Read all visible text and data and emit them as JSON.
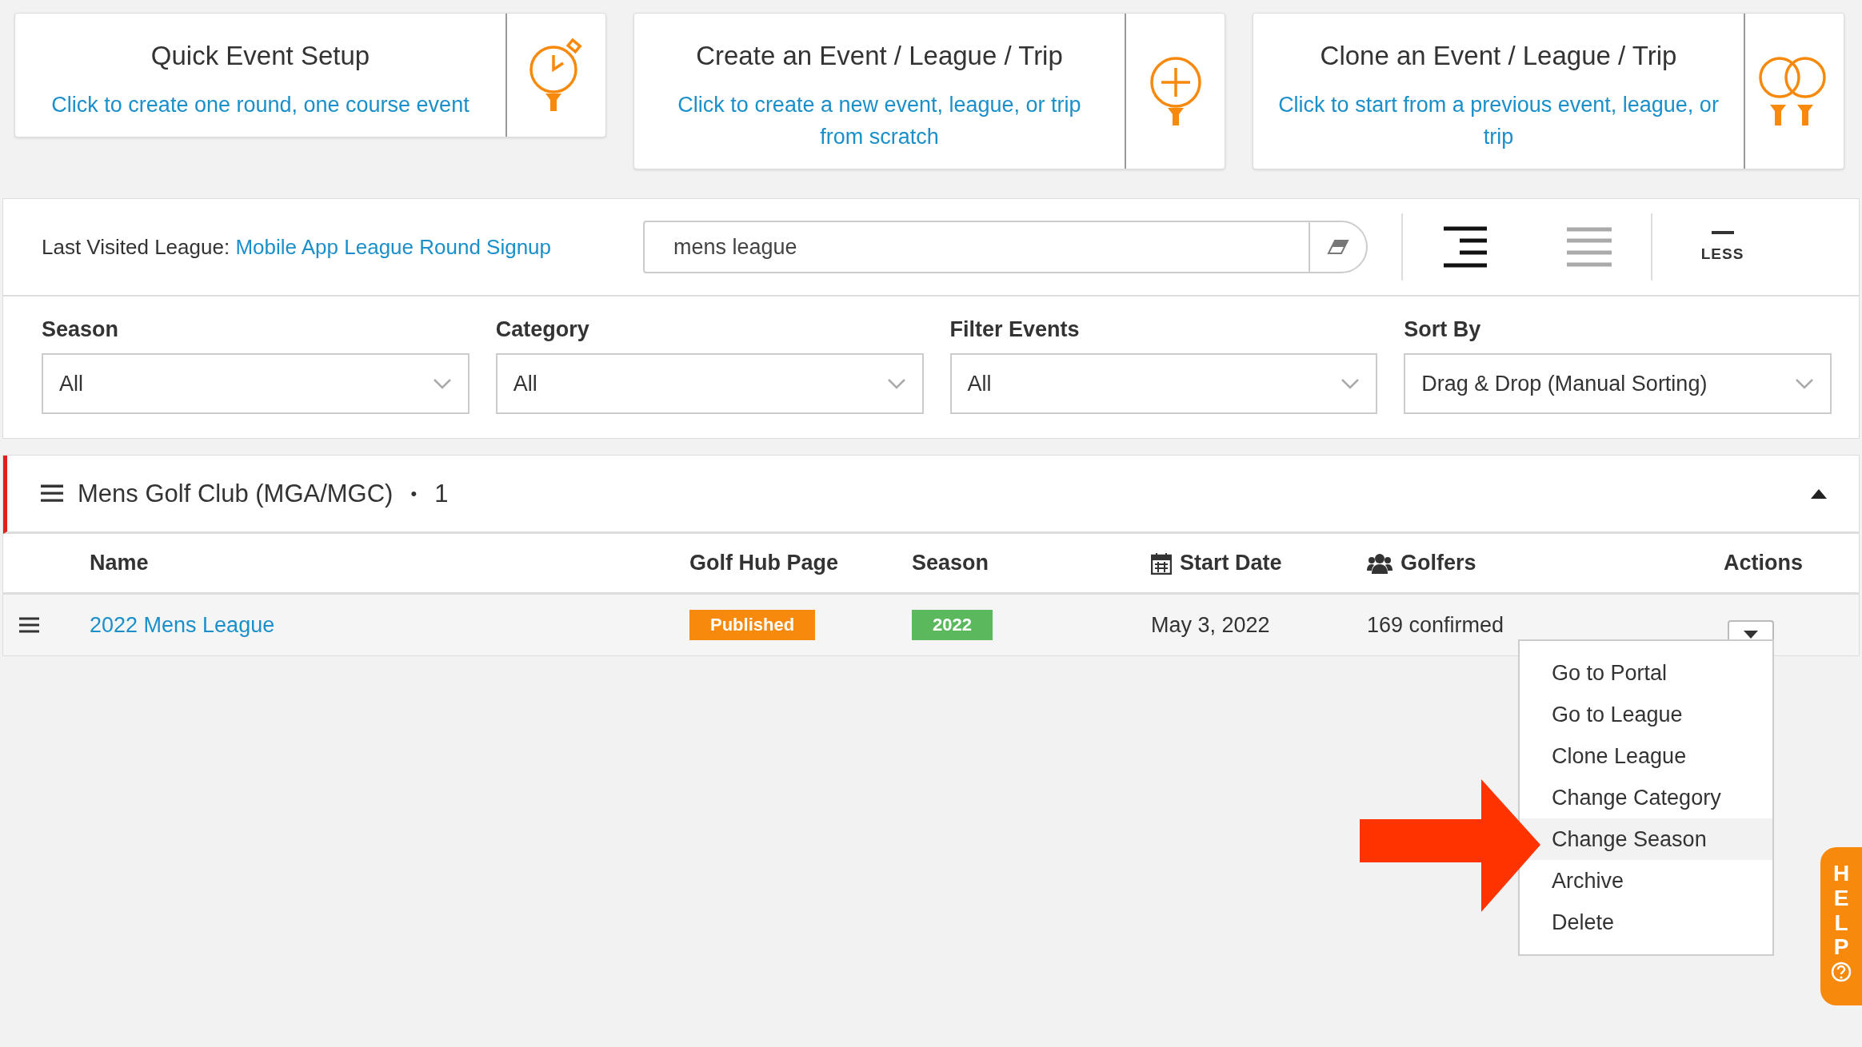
{
  "action_cards": [
    {
      "title": "Quick Event Setup",
      "link": "Click to create one round, one course event",
      "kind": "stopwatch"
    },
    {
      "title": "Create an Event / League / Trip",
      "link": "Click to create a new event, league, or trip from scratch",
      "kind": "plus"
    },
    {
      "title": "Clone an Event / League / Trip",
      "link": "Click to start from a previous event, league, or trip",
      "kind": "clone"
    }
  ],
  "last_visited": {
    "label": "Last Visited League:",
    "link": "Mobile App League Round Signup"
  },
  "search": {
    "value": "mens league"
  },
  "view_options": [
    {
      "kind": "indented",
      "selected": true
    },
    {
      "kind": "lines",
      "selected": false
    }
  ],
  "less_button": {
    "label": "LESS"
  },
  "filters": [
    {
      "label": "Season",
      "value": "All"
    },
    {
      "label": "Category",
      "value": "All"
    },
    {
      "label": "Filter Events",
      "value": "All"
    },
    {
      "label": "Sort By",
      "value": "Drag & Drop (Manual Sorting)"
    }
  ],
  "group": {
    "name": "Mens Golf Club (MGA/MGC)",
    "separator": "•",
    "count": "1",
    "expanded": true
  },
  "table": {
    "columns": [
      {
        "label": "Name",
        "kind": "plain"
      },
      {
        "label": "Golf Hub Page",
        "kind": "plain"
      },
      {
        "label": "Season",
        "kind": "plain"
      },
      {
        "label": "Start Date",
        "kind": "date"
      },
      {
        "label": "Golfers",
        "kind": "people"
      },
      {
        "label": "Actions",
        "kind": "plain"
      }
    ],
    "rows": [
      {
        "name": "2022 Mens League",
        "hub_status": "Published",
        "season": "2022",
        "start_date": "May 3, 2022",
        "golfers": "169 confirmed"
      }
    ]
  },
  "actions_menu": {
    "items": [
      {
        "label": "Go to Portal",
        "selected": false
      },
      {
        "label": "Go to League",
        "selected": false
      },
      {
        "label": "Clone League",
        "selected": false
      },
      {
        "label": "Change Category",
        "selected": false
      },
      {
        "label": "Change Season",
        "selected": true
      },
      {
        "label": "Archive",
        "selected": false
      },
      {
        "label": "Delete",
        "selected": false
      }
    ]
  },
  "help_tab": {
    "label": "HELP"
  }
}
